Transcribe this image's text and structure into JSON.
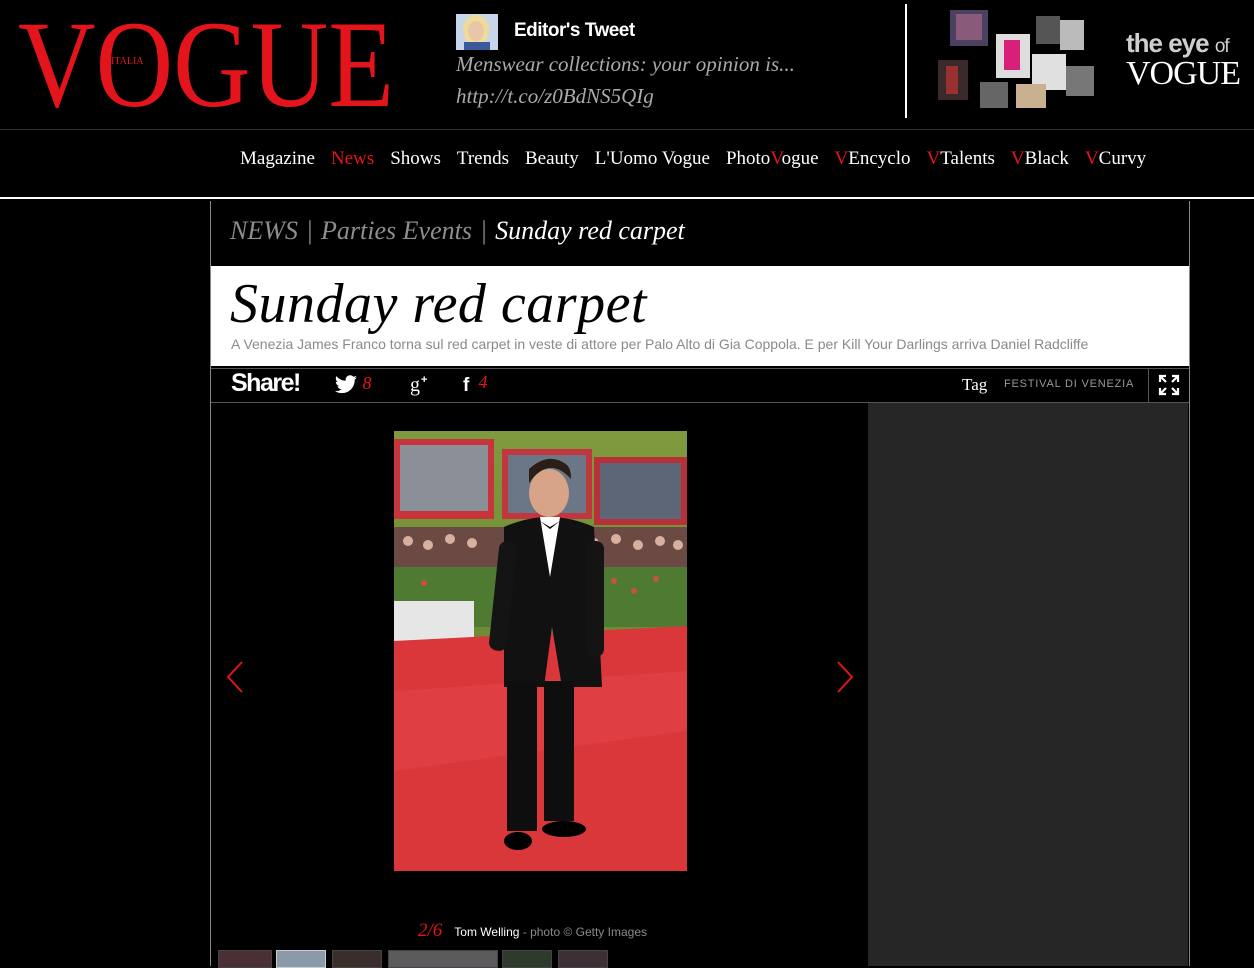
{
  "header": {
    "logo_text": "VOGUE",
    "logo_sub": "ITALIA",
    "tweet": {
      "title": "Editor's Tweet",
      "text": "Menswear collections: your opinion is...",
      "link": "http://t.co/z0BdNS5QIg"
    },
    "eye": {
      "line1_a": "the eye",
      "line1_b": "of",
      "line2": "VOGUE"
    }
  },
  "nav": {
    "items": [
      {
        "label": "Magazine",
        "active": false
      },
      {
        "label": "News",
        "active": true
      },
      {
        "label": "Shows",
        "active": false
      },
      {
        "label": "Trends",
        "active": false
      },
      {
        "label": "Beauty",
        "active": false
      },
      {
        "label": "L'Uomo Vogue",
        "active": false
      },
      {
        "label_a": "Photo",
        "label_v": "V",
        "label_b": "ogue"
      },
      {
        "label_v": "V",
        "label_b": "Encyclo"
      },
      {
        "label_v": "V",
        "label_b": "Talents"
      },
      {
        "label_v": "V",
        "label_b": "Black"
      },
      {
        "label_v": "V",
        "label_b": "Curvy"
      }
    ]
  },
  "breadcrumb": {
    "section": "NEWS",
    "category": "Parties Events",
    "current": "Sunday red carpet",
    "separator": "|"
  },
  "article": {
    "title": "Sunday red carpet",
    "subtitle": "A Venezia James Franco torna sul red carpet in veste di attore per Palo Alto di Gia Coppola. E per Kill Your Darlings arriva Daniel Radcliffe"
  },
  "share": {
    "label": "Share!",
    "twitter_count": "8",
    "gplus_count": "",
    "facebook_count": "4",
    "tag_label": "Tag",
    "tag_value": "FESTIVAL DI VENEZIA"
  },
  "gallery": {
    "counter": "2/6",
    "subject": "Tom Welling",
    "credit": " - photo © Getty Images"
  },
  "colors": {
    "accent": "#e3141b",
    "background": "#000000",
    "panel": "#262626",
    "muted_text": "#8a8a8a"
  }
}
